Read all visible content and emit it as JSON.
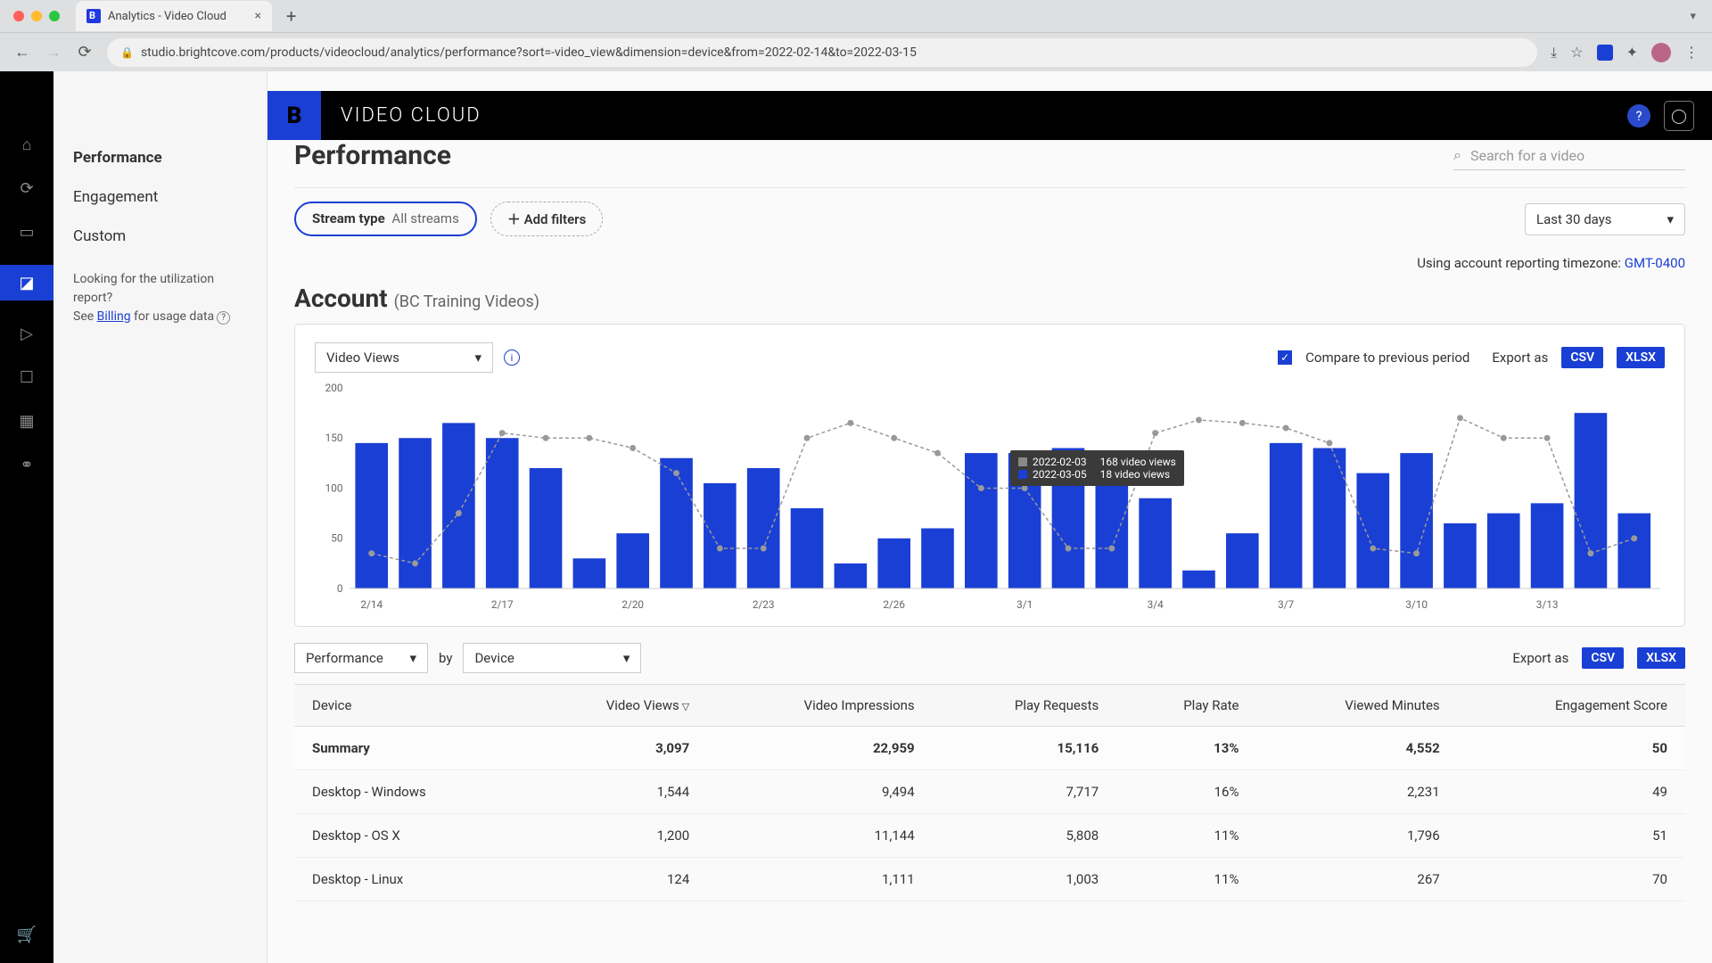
{
  "browser": {
    "tab_title": "Analytics - Video Cloud",
    "url": "studio.brightcove.com/products/videocloud/analytics/performance?sort=-video_view&dimension=device&from=2022-02-14&to=2022-03-15"
  },
  "header": {
    "product": "VIDEO CLOUD",
    "logo_letter": "B"
  },
  "sidebar": {
    "items": [
      "Performance",
      "Engagement",
      "Custom"
    ],
    "help_line1": "Looking for the utilization report?",
    "help_line2_pre": "See ",
    "help_link": "Billing",
    "help_line2_post": " for usage data"
  },
  "page": {
    "title": "Performance",
    "search_placeholder": "Search for a video"
  },
  "filters": {
    "stream_label": "Stream type",
    "stream_value": "All streams",
    "add_label": "Add filters",
    "range": "Last 30 days",
    "tz_pre": "Using account reporting timezone: ",
    "tz_val": "GMT-0400"
  },
  "account": {
    "title": "Account",
    "sub": "(BC Training Videos)"
  },
  "chart": {
    "metric": "Video Views",
    "compare_label": "Compare to previous period",
    "export_label": "Export as",
    "export_csv": "CSV",
    "export_xlsx": "XLSX",
    "tooltip": {
      "prev_date": "2022-02-03",
      "prev_val": "168 video views",
      "cur_date": "2022-03-05",
      "cur_val": "18 video views"
    }
  },
  "chart_data": {
    "type": "bar",
    "title": "Video Views",
    "ylabel": "",
    "xlabel": "",
    "ylim": [
      0,
      200
    ],
    "ticks_y": [
      0,
      50,
      100,
      150,
      200
    ],
    "ticks_x": [
      "2/14",
      "2/17",
      "2/20",
      "2/23",
      "2/26",
      "3/1",
      "3/4",
      "3/7",
      "3/10",
      "3/13"
    ],
    "categories": [
      "2/14",
      "2/15",
      "2/16",
      "2/17",
      "2/18",
      "2/19",
      "2/20",
      "2/21",
      "2/22",
      "2/23",
      "2/24",
      "2/25",
      "2/26",
      "2/27",
      "2/28",
      "3/1",
      "3/2",
      "3/3",
      "3/4",
      "3/5",
      "3/6",
      "3/7",
      "3/8",
      "3/9",
      "3/10",
      "3/11",
      "3/12",
      "3/13",
      "3/14",
      "3/15"
    ],
    "series": [
      {
        "name": "Current",
        "kind": "bar",
        "values": [
          145,
          150,
          165,
          150,
          120,
          30,
          55,
          130,
          105,
          120,
          80,
          25,
          50,
          60,
          135,
          135,
          140,
          130,
          90,
          18,
          55,
          145,
          140,
          115,
          135,
          65,
          75,
          85,
          175,
          75
        ]
      },
      {
        "name": "Previous",
        "kind": "line",
        "values": [
          35,
          25,
          75,
          155,
          150,
          150,
          140,
          115,
          40,
          40,
          150,
          165,
          150,
          135,
          100,
          100,
          40,
          40,
          155,
          168,
          165,
          160,
          145,
          40,
          35,
          170,
          150,
          150,
          35,
          50
        ]
      }
    ]
  },
  "table": {
    "export_label": "Export as",
    "export_csv": "CSV",
    "export_xlsx": "XLSX",
    "dim1": "Performance",
    "by": "by",
    "dim2": "Device",
    "columns": [
      "Device",
      "Video Views",
      "Video Impressions",
      "Play Requests",
      "Play Rate",
      "Viewed Minutes",
      "Engagement Score"
    ],
    "sort_col": 1,
    "summary": [
      "Summary",
      "3,097",
      "22,959",
      "15,116",
      "13%",
      "4,552",
      "50"
    ],
    "rows": [
      [
        "Desktop - Windows",
        "1,544",
        "9,494",
        "7,717",
        "16%",
        "2,231",
        "49"
      ],
      [
        "Desktop - OS X",
        "1,200",
        "11,144",
        "5,808",
        "11%",
        "1,796",
        "51"
      ],
      [
        "Desktop - Linux",
        "124",
        "1,111",
        "1,003",
        "11%",
        "267",
        "70"
      ]
    ]
  }
}
